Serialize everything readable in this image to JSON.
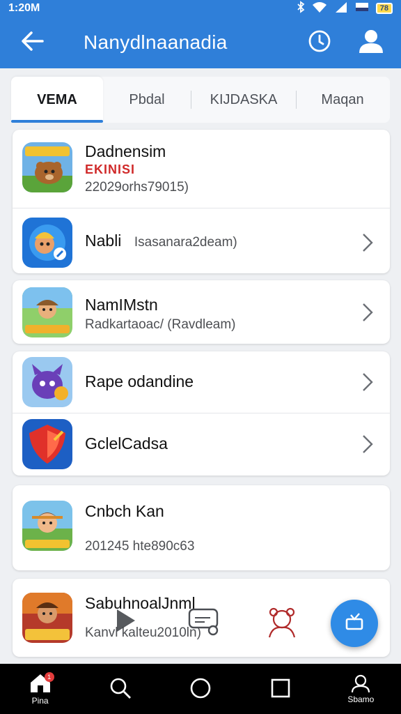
{
  "status_bar": {
    "time": "1:20M",
    "battery": "78"
  },
  "app_bar": {
    "title": "Nanydlnaanadia"
  },
  "tabs": [
    {
      "label": "VEMA"
    },
    {
      "label": "Pbdal"
    },
    {
      "label": "KIJDASKA"
    },
    {
      "label": "Maqan"
    }
  ],
  "list": [
    {
      "title": "Dadnensim",
      "badge": "EKINISI",
      "subtitle": "22029orhs79015)"
    },
    {
      "title": "Nabli",
      "subtitle": "Isasanara2deam)"
    },
    {
      "title": "NamIMstn",
      "subtitle": "Radkartaoac/ (Ravdleam)"
    },
    {
      "title": "Rape odandine"
    },
    {
      "title": "GclelCadsa"
    },
    {
      "title": "Cnbch Kan",
      "subtitle": "201245 hte890c63"
    },
    {
      "title": "SabuhnoalJnml",
      "subtitle": "Kanvl kalteu2010ln)"
    }
  ],
  "nav_bar": {
    "home_label": "Pina",
    "home_badge": "1",
    "profile_label": "Sbamo"
  },
  "colors": {
    "primary": "#2f7fd9",
    "fab": "#2f8be6",
    "badge_red": "#d02a2a"
  }
}
